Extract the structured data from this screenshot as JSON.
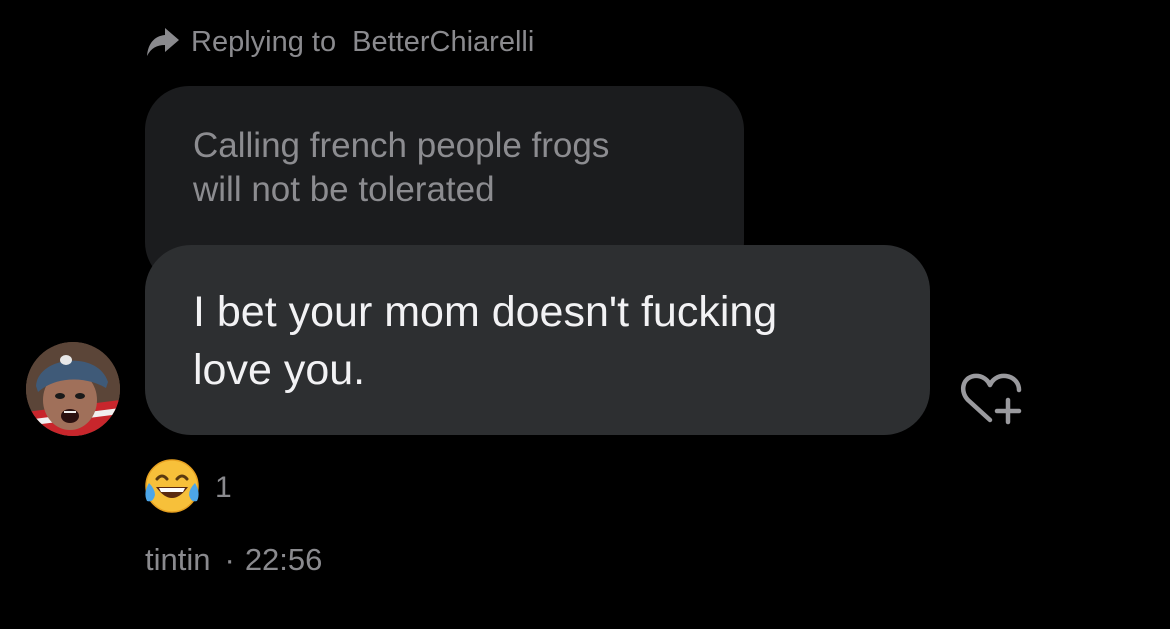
{
  "reply_header": {
    "prefix": "Replying to",
    "username": "BetterChiarelli",
    "icon": "reply-arrow-icon"
  },
  "quoted_message": {
    "text": "Calling french people frogs\nwill not be tolerated"
  },
  "message": {
    "text": "I bet your mom doesn't fucking\nlove you.",
    "react_icon": "heart-plus-icon"
  },
  "reaction": {
    "emoji_icon": "face-with-tears-of-joy-icon",
    "count": "1"
  },
  "meta": {
    "sender": "tintin",
    "separator": "·",
    "time": "22:56"
  },
  "colors": {
    "background": "#000000",
    "quoted_bubble": "#1b1c1e",
    "message_bubble": "#2d2f31",
    "secondary_text": "#8a8a8e",
    "primary_text": "#f2f2f4"
  }
}
